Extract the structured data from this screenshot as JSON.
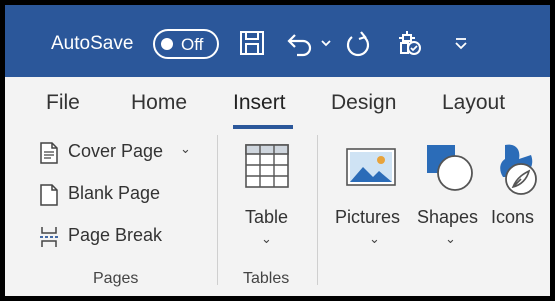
{
  "titlebar": {
    "autosave_label": "AutoSave",
    "autosave_state": "Off",
    "bg_color": "#2b579a",
    "icons": [
      "save-icon",
      "undo-icon",
      "undo-dropdown-icon",
      "redo-icon",
      "touch-mode-icon",
      "customize-qat-icon"
    ]
  },
  "tabs": [
    {
      "label": "File"
    },
    {
      "label": "Home"
    },
    {
      "label": "Insert",
      "active": true
    },
    {
      "label": "Design"
    },
    {
      "label": "Layout"
    }
  ],
  "ribbon": {
    "pages_group": {
      "label": "Pages",
      "items": [
        {
          "label": "Cover Page",
          "icon": "cover-page-icon",
          "has_dropdown": true
        },
        {
          "label": "Blank Page",
          "icon": "blank-page-icon"
        },
        {
          "label": "Page Break",
          "icon": "page-break-icon"
        }
      ]
    },
    "tables_group": {
      "label": "Tables",
      "table_button": {
        "label": "Table",
        "icon": "table-icon"
      }
    },
    "illustrations": {
      "pictures": {
        "label": "Pictures",
        "icon": "pictures-icon"
      },
      "shapes": {
        "label": "Shapes",
        "icon": "shapes-icon"
      },
      "icons": {
        "label": "Icons",
        "icon": "icons-icon"
      }
    },
    "chevron": "⌄"
  }
}
